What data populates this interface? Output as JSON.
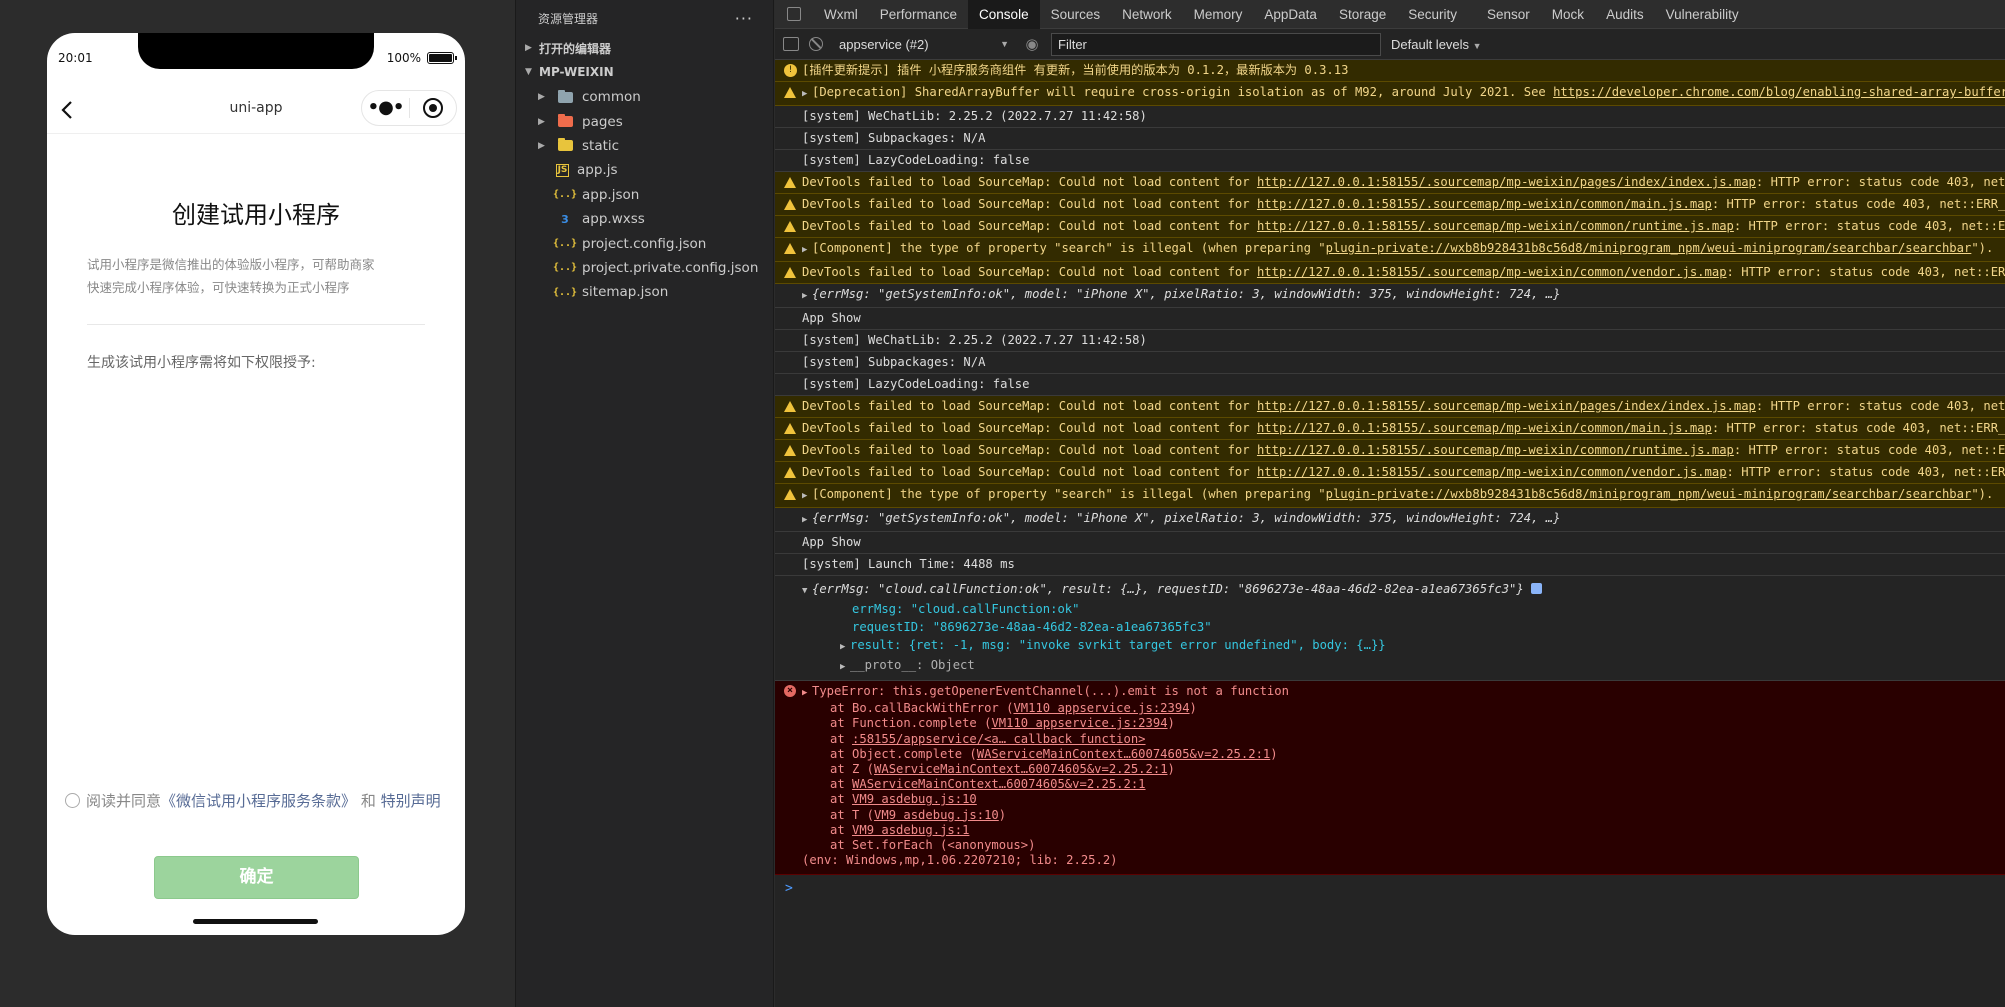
{
  "sim": {
    "time": "20:01",
    "battery": "100%",
    "nav_title": "uni-app",
    "page_title": "创建试用小程序",
    "desc_line1": "试用小程序是微信推出的体验版小程序，可帮助商家",
    "desc_line2": "快速完成小程序体验，可快速转换为正式小程序",
    "perm_text": "生成该试用小程序需将如下权限授予:",
    "agree_prefix": "阅读并同意",
    "agree_link1": "《微信试用小程序服务条款》",
    "agree_and": "和",
    "agree_link2": "特别声明",
    "confirm_label": "确定"
  },
  "explorer": {
    "title": "资源管理器",
    "open_editors": "打开的编辑器",
    "project": "MP-WEIXIN",
    "items": [
      {
        "name": "common",
        "kind": "folder",
        "color": "#90a4ae"
      },
      {
        "name": "pages",
        "kind": "folder",
        "color": "#ef6c4c"
      },
      {
        "name": "static",
        "kind": "folder",
        "color": "#e8c43c"
      },
      {
        "name": "app.js",
        "kind": "js"
      },
      {
        "name": "app.json",
        "kind": "json"
      },
      {
        "name": "app.wxss",
        "kind": "css"
      },
      {
        "name": "project.config.json",
        "kind": "json"
      },
      {
        "name": "project.private.config.json",
        "kind": "json"
      },
      {
        "name": "sitemap.json",
        "kind": "json"
      }
    ]
  },
  "devtools": {
    "tabs": [
      "Wxml",
      "Performance",
      "Console",
      "Sources",
      "Network",
      "Memory",
      "AppData",
      "Storage",
      "Security",
      "Sensor",
      "Mock",
      "Audits",
      "Vulnerability"
    ],
    "active_tab": "Console",
    "context": "appservice (#2)",
    "filter_placeholder": "Filter",
    "levels": "Default levels",
    "logs": {
      "plugin_update": "[插件更新提示] 插件 小程序服务商组件 有更新，当前使用的版本为 0.1.2，最新版本为 0.3.13",
      "deprecation_text": "[Deprecation] SharedArrayBuffer will require cross-origin isolation as of M92, around July 2021. See ",
      "deprecation_link": "https://developer.chrome.com/blog/enabling-shared-array-buffer",
      "wechatlib": "[system] WeChatLib: 2.25.2 (2022.7.27 11:42:58)",
      "subpackages": "[system] Subpackages: N/A",
      "lazy": "[system] LazyCodeLoading: false",
      "sm_prefix": "DevTools failed to load SourceMap: Could not load content for ",
      "sm_index": "http://127.0.0.1:58155/.sourcemap/mp-weixin/pages/index/index.js.map",
      "sm_index_tail": ": HTTP error: status code 403, net",
      "sm_main": "http://127.0.0.1:58155/.sourcemap/mp-weixin/common/main.js.map",
      "sm_main_tail": ": HTTP error: status code 403, net::ERR_",
      "sm_runtime": "http://127.0.0.1:58155/.sourcemap/mp-weixin/common/runtime.js.map",
      "sm_runtime_tail": ": HTTP error: status code 403, net::E",
      "sm_vendor": "http://127.0.0.1:58155/.sourcemap/mp-weixin/common/vendor.js.map",
      "sm_vendor_tail": ": HTTP error: status code 403, net::ER",
      "component_prefix": "[Component] the type of property \"search\" is illegal (when preparing \"",
      "component_link": "plugin-private://wxb8b928431b8c56d8/miniprogram_npm/weui-miniprogram/searchbar/searchbar",
      "component_tail": "\").",
      "sysinfo": "{errMsg: \"getSystemInfo:ok\", model: \"iPhone X\", pixelRatio: 3, windowWidth: 375, windowHeight: 724, …}",
      "app_show": "App Show",
      "launch": "[system] Launch Time: 4488 ms",
      "cloud_summary": "{errMsg: \"cloud.callFunction:ok\", result: {…}, requestID: \"8696273e-48aa-46d2-82ea-a1ea67365fc3\"}",
      "cloud_errmsg": "errMsg: \"cloud.callFunction:ok\"",
      "cloud_reqid": "requestID: \"8696273e-48aa-46d2-82ea-a1ea67365fc3\"",
      "cloud_result": "result: {ret: -1, msg: \"invoke svrkit target error undefined\", body: {…}}",
      "cloud_proto": "__proto__: Object"
    },
    "error": {
      "title": "TypeError: this.getOpenerEventChannel(...).emit is not a function",
      "stack": [
        {
          "pre": "at Bo.callBackWithError (",
          "link": "VM110 appservice.js:2394",
          "post": ")"
        },
        {
          "pre": "at Function.complete (",
          "link": "VM110 appservice.js:2394",
          "post": ")"
        },
        {
          "pre": "at ",
          "link": ":58155/appservice/<a… callback function>",
          "post": ""
        },
        {
          "pre": "at Object.complete (",
          "link": "WAServiceMainContext…60074605&v=2.25.2:1",
          "post": ")"
        },
        {
          "pre": "at Z (",
          "link": "WAServiceMainContext…60074605&v=2.25.2:1",
          "post": ")"
        },
        {
          "pre": "at ",
          "link": "WAServiceMainContext…60074605&v=2.25.2:1",
          "post": ""
        },
        {
          "pre": "at ",
          "link": "VM9 asdebug.js:10",
          "post": ""
        },
        {
          "pre": "at T (",
          "link": "VM9 asdebug.js:10",
          "post": ")"
        },
        {
          "pre": "at ",
          "link": "VM9 asdebug.js:1",
          "post": ""
        },
        {
          "pre": "at Set.forEach (<anonymous>)",
          "link": "",
          "post": ""
        }
      ],
      "env": "(env: Windows,mp,1.06.2207210; lib: 2.25.2)"
    },
    "prompt": ">"
  }
}
